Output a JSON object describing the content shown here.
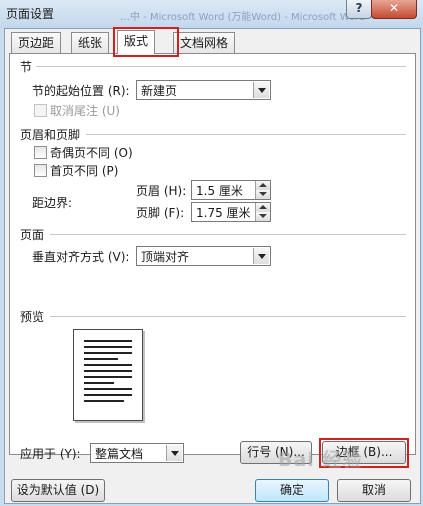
{
  "window": {
    "title": "页面设置",
    "background_title": "…中 - Microsoft Word (万能Word) - Microsoft Word"
  },
  "tabs": [
    {
      "label": "页边距"
    },
    {
      "label": "纸张"
    },
    {
      "label": "版式"
    },
    {
      "label": "文档网格"
    }
  ],
  "section_start": {
    "heading": "节",
    "start_label": "节的起始位置 (R):",
    "start_value": "新建页",
    "suppress_endnotes_label": "取消尾注 (U)"
  },
  "headers_footers": {
    "heading": "页眉和页脚",
    "odd_even_label": "奇偶页不同 (O)",
    "first_page_label": "首页不同 (P)",
    "from_edge_label": "距边界:",
    "header_label": "页眉 (H):",
    "header_value": "1.5 厘米",
    "footer_label": "页脚 (F):",
    "footer_value": "1.75 厘米"
  },
  "page": {
    "heading": "页面",
    "vertical_align_label": "垂直对齐方式 (V):",
    "vertical_align_value": "顶端对齐"
  },
  "preview": {
    "heading": "预览"
  },
  "apply_to": {
    "label": "应用于 (Y):",
    "value": "整篇文档"
  },
  "buttons": {
    "line_numbers": "行号 (N)...",
    "borders": "边框 (B)...",
    "set_default": "设为默认值 (D)",
    "ok": "确定",
    "cancel": "取消"
  },
  "watermark": "Bai 经验"
}
